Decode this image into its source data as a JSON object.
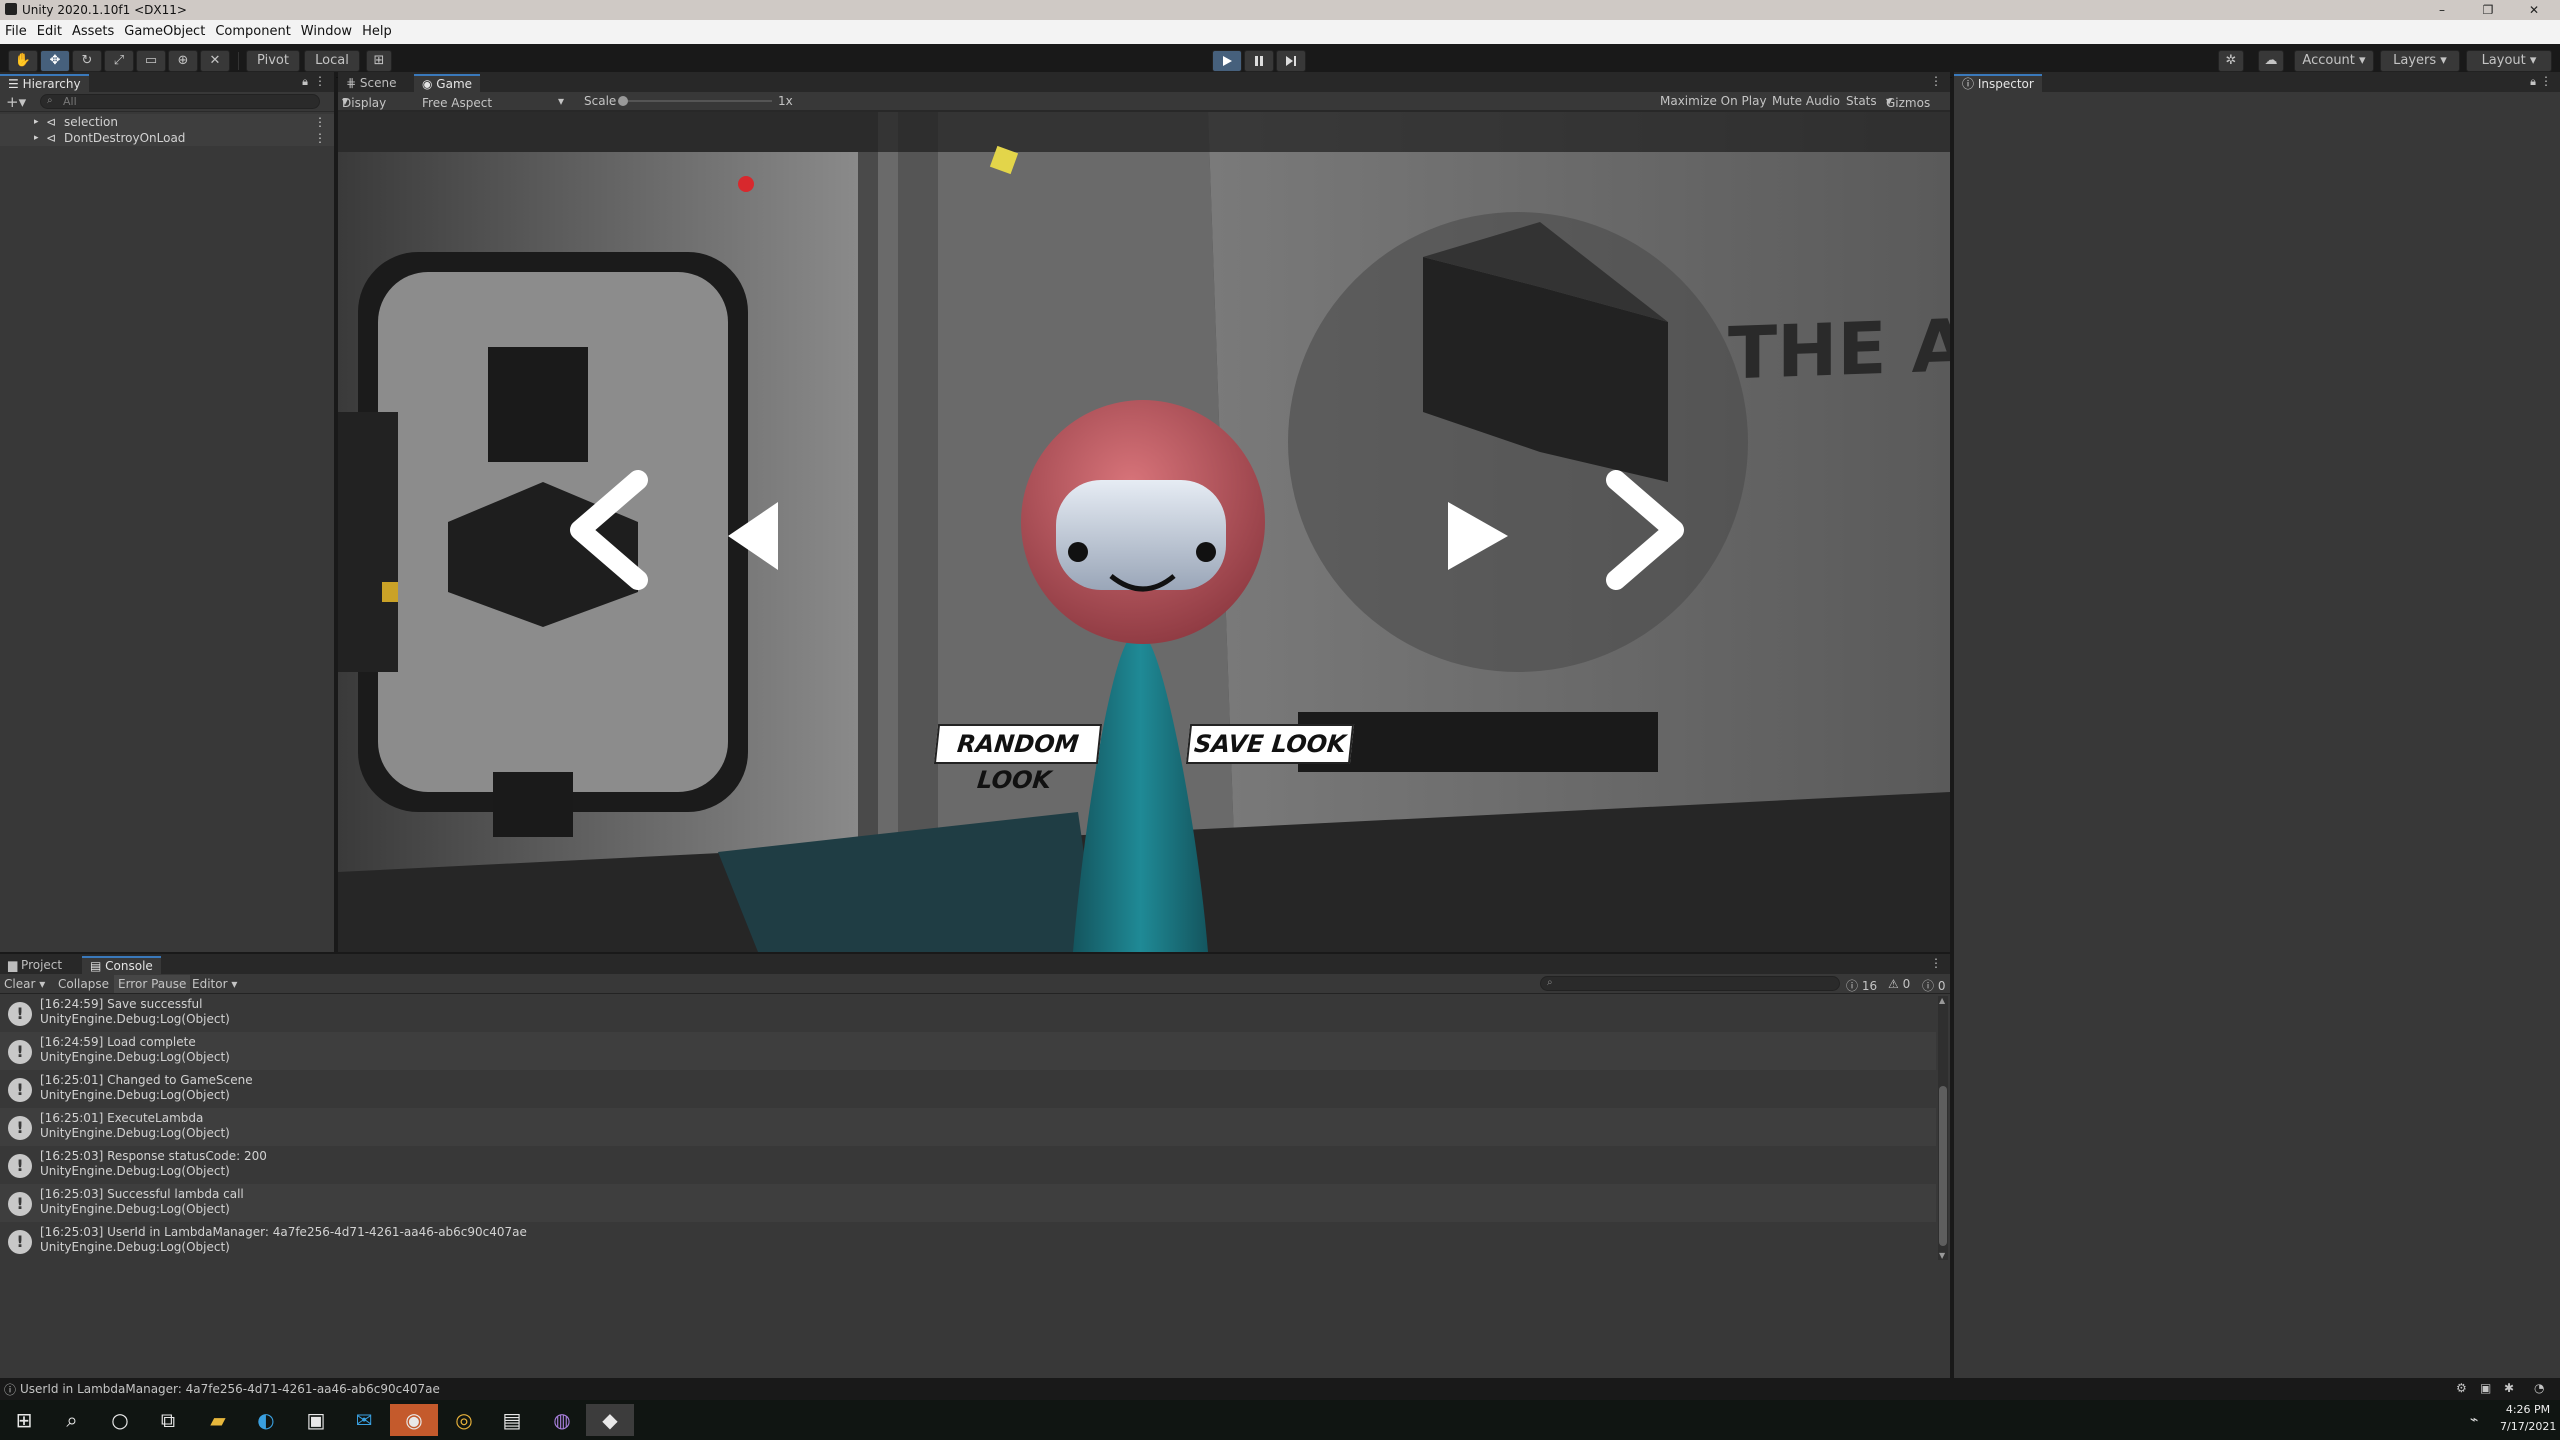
{
  "window": {
    "title": "Unity 2020.1.10f1 <DX11>",
    "controls": {
      "minimize": "–",
      "restore": "❐",
      "close": "✕"
    }
  },
  "menu": [
    "File",
    "Edit",
    "Assets",
    "GameObject",
    "Component",
    "Window",
    "Help"
  ],
  "toolbar": {
    "pivot_label": "Pivot",
    "local_label": "Local",
    "account_label": "Account",
    "layers_label": "Layers",
    "layout_label": "Layout",
    "play_icon": "play-icon",
    "pause_icon": "pause-icon",
    "step_icon": "step-icon"
  },
  "hierarchy": {
    "tab": "Hierarchy",
    "search_placeholder": "All",
    "items": [
      "selection",
      "DontDestroyOnLoad"
    ]
  },
  "scene_tabs": [
    "Scene",
    "Game"
  ],
  "game_controls": {
    "display": "Display 1",
    "aspect": "Free Aspect",
    "scale_label": "Scale",
    "scale_value": "1x",
    "maximize": "Maximize On Play",
    "mute": "Mute Audio",
    "stats": "Stats",
    "gizmos": "Gizmos"
  },
  "game": {
    "wall_text": "THE A",
    "random_button": "RANDOM LOOK",
    "save_button": "SAVE LOOK"
  },
  "inspector": {
    "tab": "Inspector"
  },
  "console": {
    "tabs": [
      "Project",
      "Console"
    ],
    "tools": [
      "Clear",
      "Collapse",
      "Error Pause",
      "Editor"
    ],
    "counts": {
      "info": "16",
      "warn": "0",
      "error": "0"
    },
    "logs": [
      {
        "line1": "[16:24:59] Save successful",
        "line2": "UnityEngine.Debug:Log(Object)"
      },
      {
        "line1": "[16:24:59] Load complete",
        "line2": "UnityEngine.Debug:Log(Object)"
      },
      {
        "line1": "[16:25:01] Changed to GameScene",
        "line2": "UnityEngine.Debug:Log(Object)"
      },
      {
        "line1": "[16:25:01] ExecuteLambda",
        "line2": "UnityEngine.Debug:Log(Object)"
      },
      {
        "line1": "[16:25:03] Response statusCode: 200",
        "line2": "UnityEngine.Debug:Log(Object)"
      },
      {
        "line1": "[16:25:03] Successful lambda call",
        "line2": "UnityEngine.Debug:Log(Object)"
      },
      {
        "line1": "[16:25:03] UserId in LambdaManager: 4a7fe256-4d71-4261-aa46-ab6c90c407ae",
        "line2": "UnityEngine.Debug:Log(Object)"
      }
    ]
  },
  "status_bar": {
    "message": "UserId in LambdaManager: 4a7fe256-4d71-4261-aa46-ab6c90c407ae"
  },
  "taskbar": {
    "time": "4:26 PM",
    "date": "7/17/2021"
  }
}
